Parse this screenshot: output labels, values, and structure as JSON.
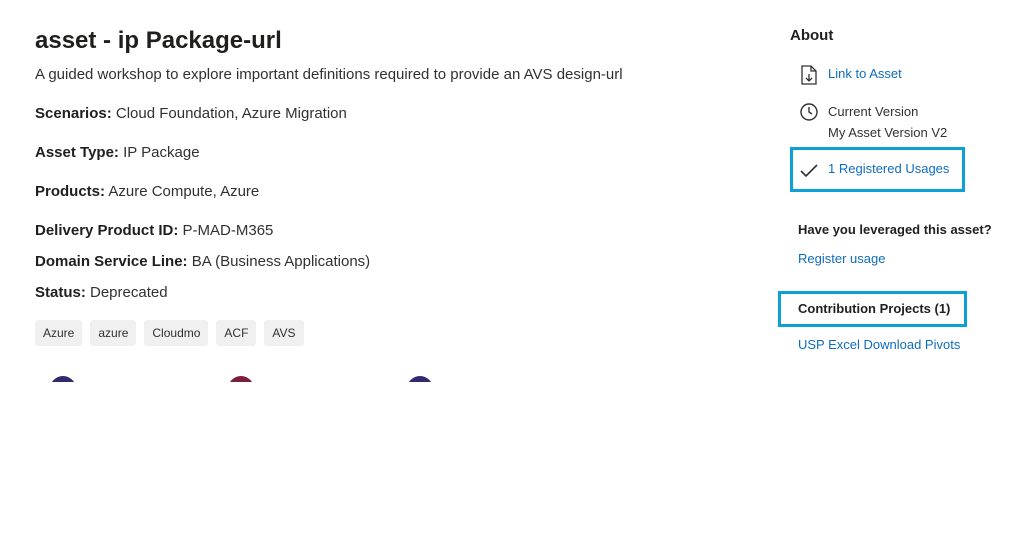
{
  "asset": {
    "title": "asset - ip Package-url",
    "description": "A guided workshop to explore important definitions required to provide an AVS design-url",
    "fields": [
      {
        "label": "Scenarios:",
        "value": " Cloud Foundation, Azure Migration"
      },
      {
        "label": "Asset Type:",
        "value": " IP Package"
      },
      {
        "label": "Products:",
        "value": " Azure Compute, Azure"
      },
      {
        "label": "Delivery Product ID:",
        "value": " P-MAD-M365"
      },
      {
        "label": "Domain Service Line:",
        "value": " BA (Business Applications)"
      },
      {
        "label": "Status:",
        "value": " Deprecated"
      }
    ],
    "tags": [
      "Azure",
      "azure",
      "Cloudmo",
      "ACF",
      "AVS"
    ]
  },
  "about": {
    "heading": "About",
    "link_to_asset": "Link to Asset",
    "current_version_label": "Current Version",
    "current_version_value": "My Asset Version V2",
    "registered_usages": "1 Registered Usages",
    "question": "Have you leveraged this asset?",
    "register_usage": "Register usage",
    "contribution_projects": "Contribution Projects (1)",
    "project_link": "USP Excel Download Pivots"
  },
  "colors": {
    "link": "#0f6cbd",
    "highlight_border": "#0d9fd8",
    "tag_bg": "#f0f0f0"
  },
  "icons": [
    "document-download-icon",
    "clock-icon",
    "checkmark-icon"
  ]
}
